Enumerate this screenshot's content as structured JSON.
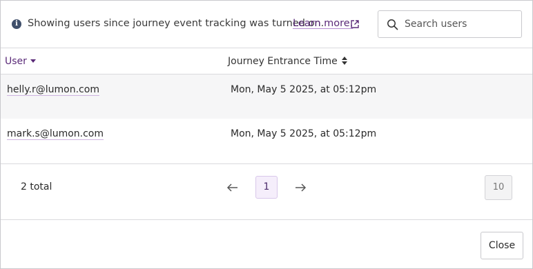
{
  "notice": {
    "text": "Showing users since journey event tracking was turned on.",
    "link_label": "Learn more.",
    "icon": "info-icon",
    "link_icon": "external-link-icon"
  },
  "search": {
    "placeholder": "Search users",
    "value": "",
    "icon": "search-icon"
  },
  "table": {
    "columns": [
      {
        "label": "User",
        "sort": "descending"
      },
      {
        "label": "Journey Entrance Time",
        "sort": "unsorted"
      }
    ],
    "rows": [
      {
        "user": "helly.r@lumon.com",
        "time": "Mon, May 5 2025, at 05:12pm"
      },
      {
        "user": "mark.s@lumon.com",
        "time": "Mon, May 5 2025, at 05:12pm"
      }
    ]
  },
  "pagination": {
    "total_label": "2 total",
    "current_page": "1",
    "per_page": "10"
  },
  "footer": {
    "close_label": "Close"
  },
  "colors": {
    "accent": "#5a2a78",
    "page_active_bg": "#f5eefb",
    "row_alt_bg": "#f6f6f7",
    "info_icon": "#40506b"
  }
}
